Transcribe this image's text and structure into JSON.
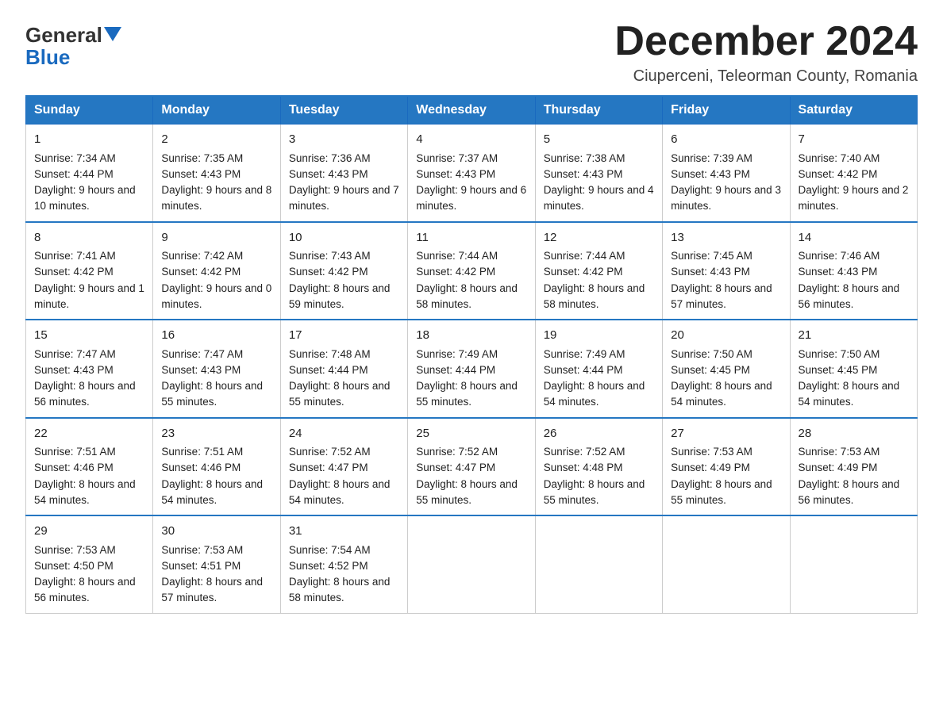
{
  "logo": {
    "line1": "General",
    "arrow": true,
    "line2": "Blue"
  },
  "title": "December 2024",
  "location": "Ciuperceni, Teleorman County, Romania",
  "days_of_week": [
    "Sunday",
    "Monday",
    "Tuesday",
    "Wednesday",
    "Thursday",
    "Friday",
    "Saturday"
  ],
  "weeks": [
    [
      {
        "day": "1",
        "sunrise": "7:34 AM",
        "sunset": "4:44 PM",
        "daylight": "9 hours and 10 minutes."
      },
      {
        "day": "2",
        "sunrise": "7:35 AM",
        "sunset": "4:43 PM",
        "daylight": "9 hours and 8 minutes."
      },
      {
        "day": "3",
        "sunrise": "7:36 AM",
        "sunset": "4:43 PM",
        "daylight": "9 hours and 7 minutes."
      },
      {
        "day": "4",
        "sunrise": "7:37 AM",
        "sunset": "4:43 PM",
        "daylight": "9 hours and 6 minutes."
      },
      {
        "day": "5",
        "sunrise": "7:38 AM",
        "sunset": "4:43 PM",
        "daylight": "9 hours and 4 minutes."
      },
      {
        "day": "6",
        "sunrise": "7:39 AM",
        "sunset": "4:43 PM",
        "daylight": "9 hours and 3 minutes."
      },
      {
        "day": "7",
        "sunrise": "7:40 AM",
        "sunset": "4:42 PM",
        "daylight": "9 hours and 2 minutes."
      }
    ],
    [
      {
        "day": "8",
        "sunrise": "7:41 AM",
        "sunset": "4:42 PM",
        "daylight": "9 hours and 1 minute."
      },
      {
        "day": "9",
        "sunrise": "7:42 AM",
        "sunset": "4:42 PM",
        "daylight": "9 hours and 0 minutes."
      },
      {
        "day": "10",
        "sunrise": "7:43 AM",
        "sunset": "4:42 PM",
        "daylight": "8 hours and 59 minutes."
      },
      {
        "day": "11",
        "sunrise": "7:44 AM",
        "sunset": "4:42 PM",
        "daylight": "8 hours and 58 minutes."
      },
      {
        "day": "12",
        "sunrise": "7:44 AM",
        "sunset": "4:42 PM",
        "daylight": "8 hours and 58 minutes."
      },
      {
        "day": "13",
        "sunrise": "7:45 AM",
        "sunset": "4:43 PM",
        "daylight": "8 hours and 57 minutes."
      },
      {
        "day": "14",
        "sunrise": "7:46 AM",
        "sunset": "4:43 PM",
        "daylight": "8 hours and 56 minutes."
      }
    ],
    [
      {
        "day": "15",
        "sunrise": "7:47 AM",
        "sunset": "4:43 PM",
        "daylight": "8 hours and 56 minutes."
      },
      {
        "day": "16",
        "sunrise": "7:47 AM",
        "sunset": "4:43 PM",
        "daylight": "8 hours and 55 minutes."
      },
      {
        "day": "17",
        "sunrise": "7:48 AM",
        "sunset": "4:44 PM",
        "daylight": "8 hours and 55 minutes."
      },
      {
        "day": "18",
        "sunrise": "7:49 AM",
        "sunset": "4:44 PM",
        "daylight": "8 hours and 55 minutes."
      },
      {
        "day": "19",
        "sunrise": "7:49 AM",
        "sunset": "4:44 PM",
        "daylight": "8 hours and 54 minutes."
      },
      {
        "day": "20",
        "sunrise": "7:50 AM",
        "sunset": "4:45 PM",
        "daylight": "8 hours and 54 minutes."
      },
      {
        "day": "21",
        "sunrise": "7:50 AM",
        "sunset": "4:45 PM",
        "daylight": "8 hours and 54 minutes."
      }
    ],
    [
      {
        "day": "22",
        "sunrise": "7:51 AM",
        "sunset": "4:46 PM",
        "daylight": "8 hours and 54 minutes."
      },
      {
        "day": "23",
        "sunrise": "7:51 AM",
        "sunset": "4:46 PM",
        "daylight": "8 hours and 54 minutes."
      },
      {
        "day": "24",
        "sunrise": "7:52 AM",
        "sunset": "4:47 PM",
        "daylight": "8 hours and 54 minutes."
      },
      {
        "day": "25",
        "sunrise": "7:52 AM",
        "sunset": "4:47 PM",
        "daylight": "8 hours and 55 minutes."
      },
      {
        "day": "26",
        "sunrise": "7:52 AM",
        "sunset": "4:48 PM",
        "daylight": "8 hours and 55 minutes."
      },
      {
        "day": "27",
        "sunrise": "7:53 AM",
        "sunset": "4:49 PM",
        "daylight": "8 hours and 55 minutes."
      },
      {
        "day": "28",
        "sunrise": "7:53 AM",
        "sunset": "4:49 PM",
        "daylight": "8 hours and 56 minutes."
      }
    ],
    [
      {
        "day": "29",
        "sunrise": "7:53 AM",
        "sunset": "4:50 PM",
        "daylight": "8 hours and 56 minutes."
      },
      {
        "day": "30",
        "sunrise": "7:53 AM",
        "sunset": "4:51 PM",
        "daylight": "8 hours and 57 minutes."
      },
      {
        "day": "31",
        "sunrise": "7:54 AM",
        "sunset": "4:52 PM",
        "daylight": "8 hours and 58 minutes."
      },
      null,
      null,
      null,
      null
    ]
  ],
  "labels": {
    "sunrise": "Sunrise:",
    "sunset": "Sunset:",
    "daylight": "Daylight:"
  }
}
